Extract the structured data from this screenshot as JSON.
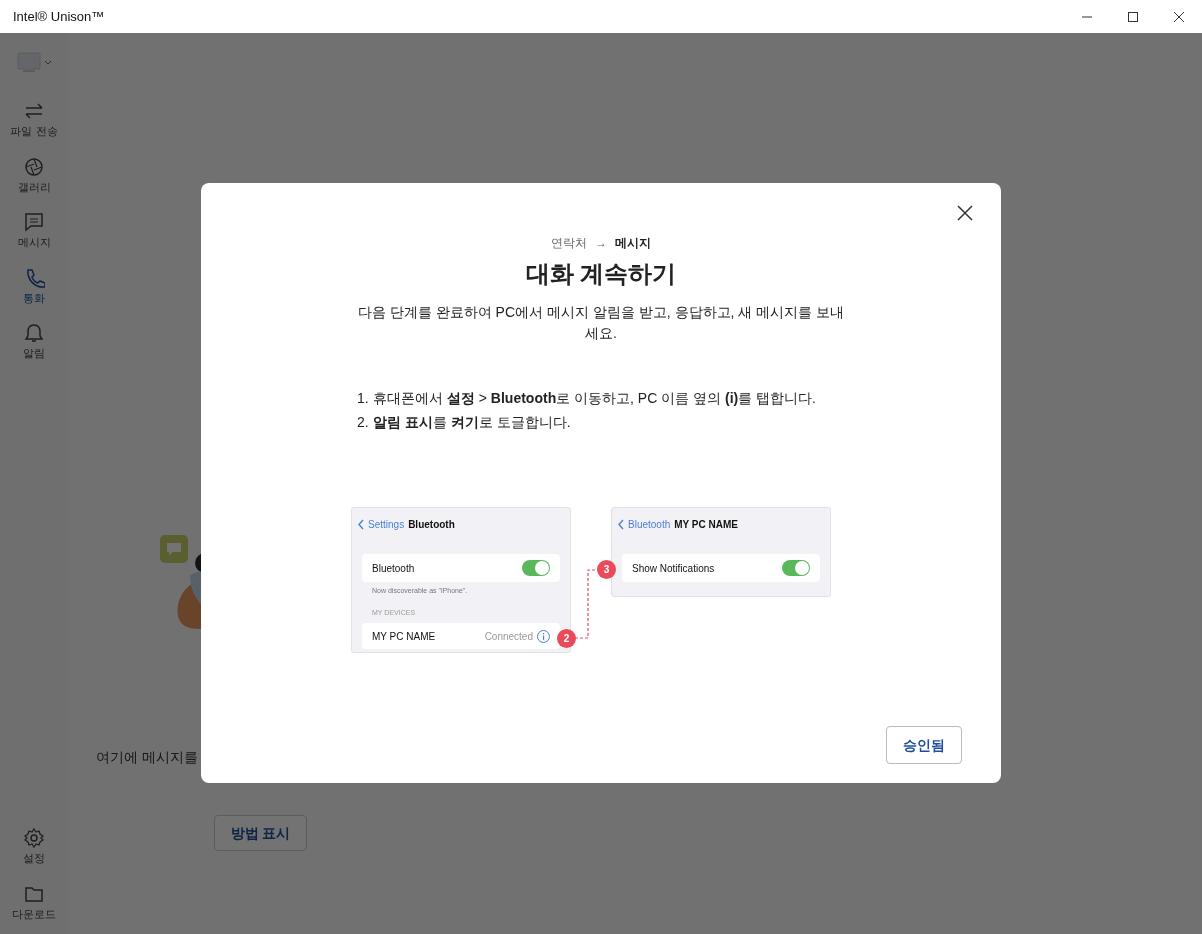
{
  "window": {
    "title": "Intel® Unison™"
  },
  "sidebar": {
    "items": [
      {
        "label": "파일 전송",
        "selected": false
      },
      {
        "label": "갤러리",
        "selected": false
      },
      {
        "label": "메시지",
        "selected": false
      },
      {
        "label": "통화",
        "selected": true
      },
      {
        "label": "알림",
        "selected": false
      }
    ],
    "bottom_items": [
      {
        "label": "설정"
      },
      {
        "label": "다운로드"
      }
    ]
  },
  "background": {
    "text": "여기에 메시지를",
    "button": "방법 표시"
  },
  "dialog": {
    "breadcrumb": [
      "연락처",
      "→",
      "메시지"
    ],
    "title": "대화 계속하기",
    "description": "다음 단계를 완료하여 PC에서 메시지 알림을 받고, 응답하고, 새 메시지를 보내세요.",
    "steps": [
      {
        "number": "1.",
        "text": "휴대폰에서 **설정** > **Bluetooth**로 이동하고, PC 이름 옆의 **(i)**를 탭합니다."
      },
      {
        "number": "2.",
        "text": "**알림 표시**를 **켜기**로 토글합니다."
      }
    ],
    "screens": [
      {
        "back": "Settings",
        "title": "Bluetooth",
        "toggle": {
          "label": "Bluetooth",
          "on": true
        },
        "caption": "Now discoverable as \"iPhone\".",
        "section": "MY DEVICES",
        "device": {
          "name": "MY PC NAME",
          "status": "Connected"
        },
        "badge": "2"
      },
      {
        "back": "Bluetooth",
        "title": "MY PC NAME",
        "toggle": {
          "label": "Show Notifications",
          "on": true
        },
        "badge": "3"
      }
    ],
    "button": "승인됨"
  }
}
